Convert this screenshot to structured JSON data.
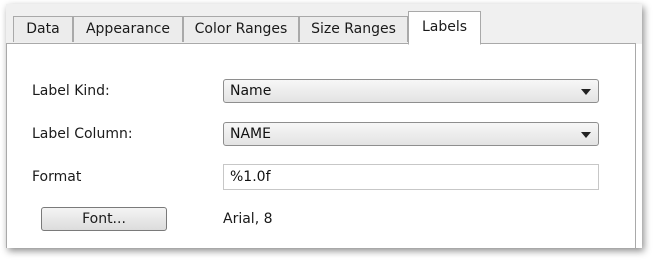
{
  "tabs": [
    {
      "label": "Data"
    },
    {
      "label": "Appearance"
    },
    {
      "label": "Color Ranges"
    },
    {
      "label": "Size Ranges"
    },
    {
      "label": "Labels",
      "active": true
    }
  ],
  "form": {
    "label_kind": {
      "label": "Label Kind:",
      "value": "Name"
    },
    "label_column": {
      "label": "Label Column:",
      "value": "NAME"
    },
    "format": {
      "label": "Format",
      "value": "%1.0f"
    },
    "font": {
      "button_label": "Font...",
      "value": "Arial, 8"
    }
  },
  "icons": {
    "dropdown": "chevron-down-icon"
  }
}
